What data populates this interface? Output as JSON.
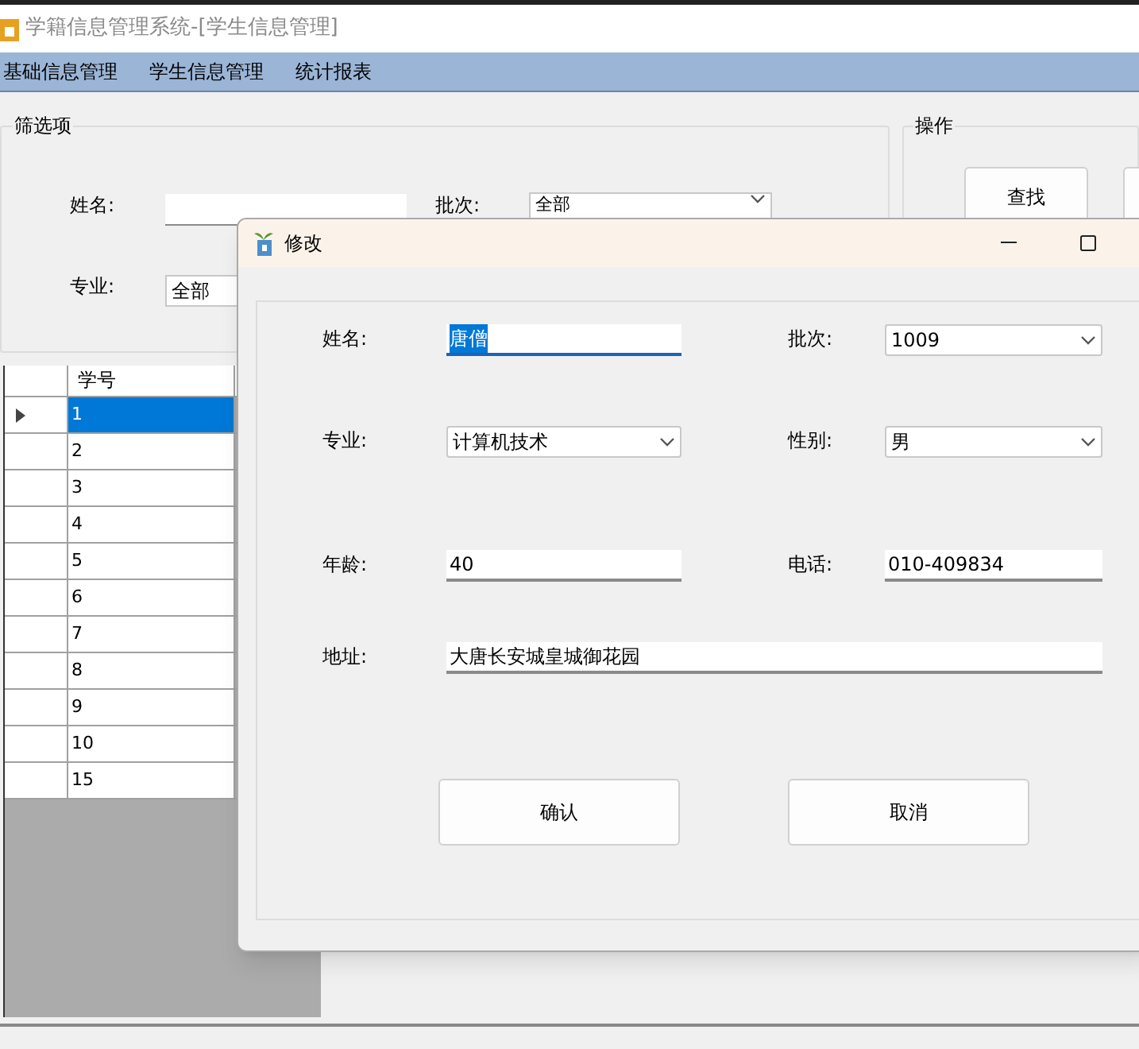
{
  "window": {
    "title": "学籍信息管理系统-[学生信息管理]"
  },
  "menu": [
    "基础信息管理",
    "学生信息管理",
    "统计报表"
  ],
  "filter": {
    "title": "筛选项",
    "name_label": "姓名:",
    "batch_label": "批次:",
    "batch_value": "全部",
    "major_label": "专业:",
    "major_value": "全部"
  },
  "actions": {
    "title": "操作",
    "buttons": [
      "查找"
    ]
  },
  "grid": {
    "columns": [
      "学号"
    ],
    "rows": [
      {
        "cell": "1",
        "selected": true
      },
      {
        "cell": "2",
        "selected": false
      },
      {
        "cell": "3",
        "selected": false
      },
      {
        "cell": "4",
        "selected": false
      },
      {
        "cell": "5",
        "selected": false
      },
      {
        "cell": "6",
        "selected": false
      },
      {
        "cell": "7",
        "selected": false
      },
      {
        "cell": "8",
        "selected": false
      },
      {
        "cell": "9",
        "selected": false
      },
      {
        "cell": "10",
        "selected": false
      },
      {
        "cell": "15",
        "selected": false
      }
    ]
  },
  "dialog": {
    "title": "修改",
    "fields": [
      {
        "label": "姓名:",
        "value": "唐僧",
        "kind": "text",
        "text_selected": true
      },
      {
        "label": "批次:",
        "value": "1009",
        "kind": "combo"
      },
      {
        "label": "专业:",
        "value": "计算机技术",
        "kind": "combo"
      },
      {
        "label": "性别:",
        "value": "男",
        "kind": "combo"
      },
      {
        "label": "年龄:",
        "value": "40",
        "kind": "text"
      },
      {
        "label": "电话:",
        "value": "010-409834",
        "kind": "text"
      },
      {
        "label": "地址:",
        "value": "大唐长安城皇城御花园",
        "kind": "text"
      }
    ],
    "buttons": [
      "确认",
      "取消"
    ]
  }
}
